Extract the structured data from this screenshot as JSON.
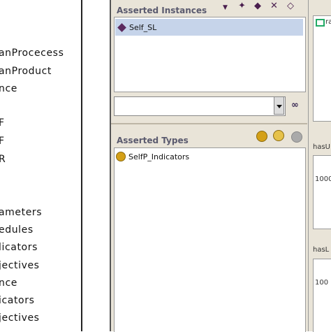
{
  "tree": {
    "items": [
      "anProcecess",
      "anProduct",
      "nce",
      "F",
      "F",
      "R",
      "",
      "ameters",
      "edules",
      "licators",
      "jectives",
      "nce",
      "icators",
      "jectives"
    ]
  },
  "instances": {
    "header": "Asserted Instances",
    "items": [
      "Self_SL"
    ],
    "toolbar_icons": [
      "dropdown-arrow-icon",
      "add-instance-icon",
      "instance-icon",
      "delete-icon",
      "more-icon"
    ]
  },
  "search": {
    "value": ""
  },
  "types": {
    "header": "Asserted Types",
    "items": [
      "SelfP_Indicators"
    ]
  },
  "right": {
    "top_label": "ra",
    "prop1_label": "hasU",
    "prop1_value": "1000",
    "prop2_label": "hasL",
    "prop2_value": "100"
  },
  "colors": {
    "panel_bg": "#e9e4d8",
    "selection": "#c6d4ea",
    "instance_icon": "#5b2a5e",
    "class_icon": "#d4a017"
  }
}
